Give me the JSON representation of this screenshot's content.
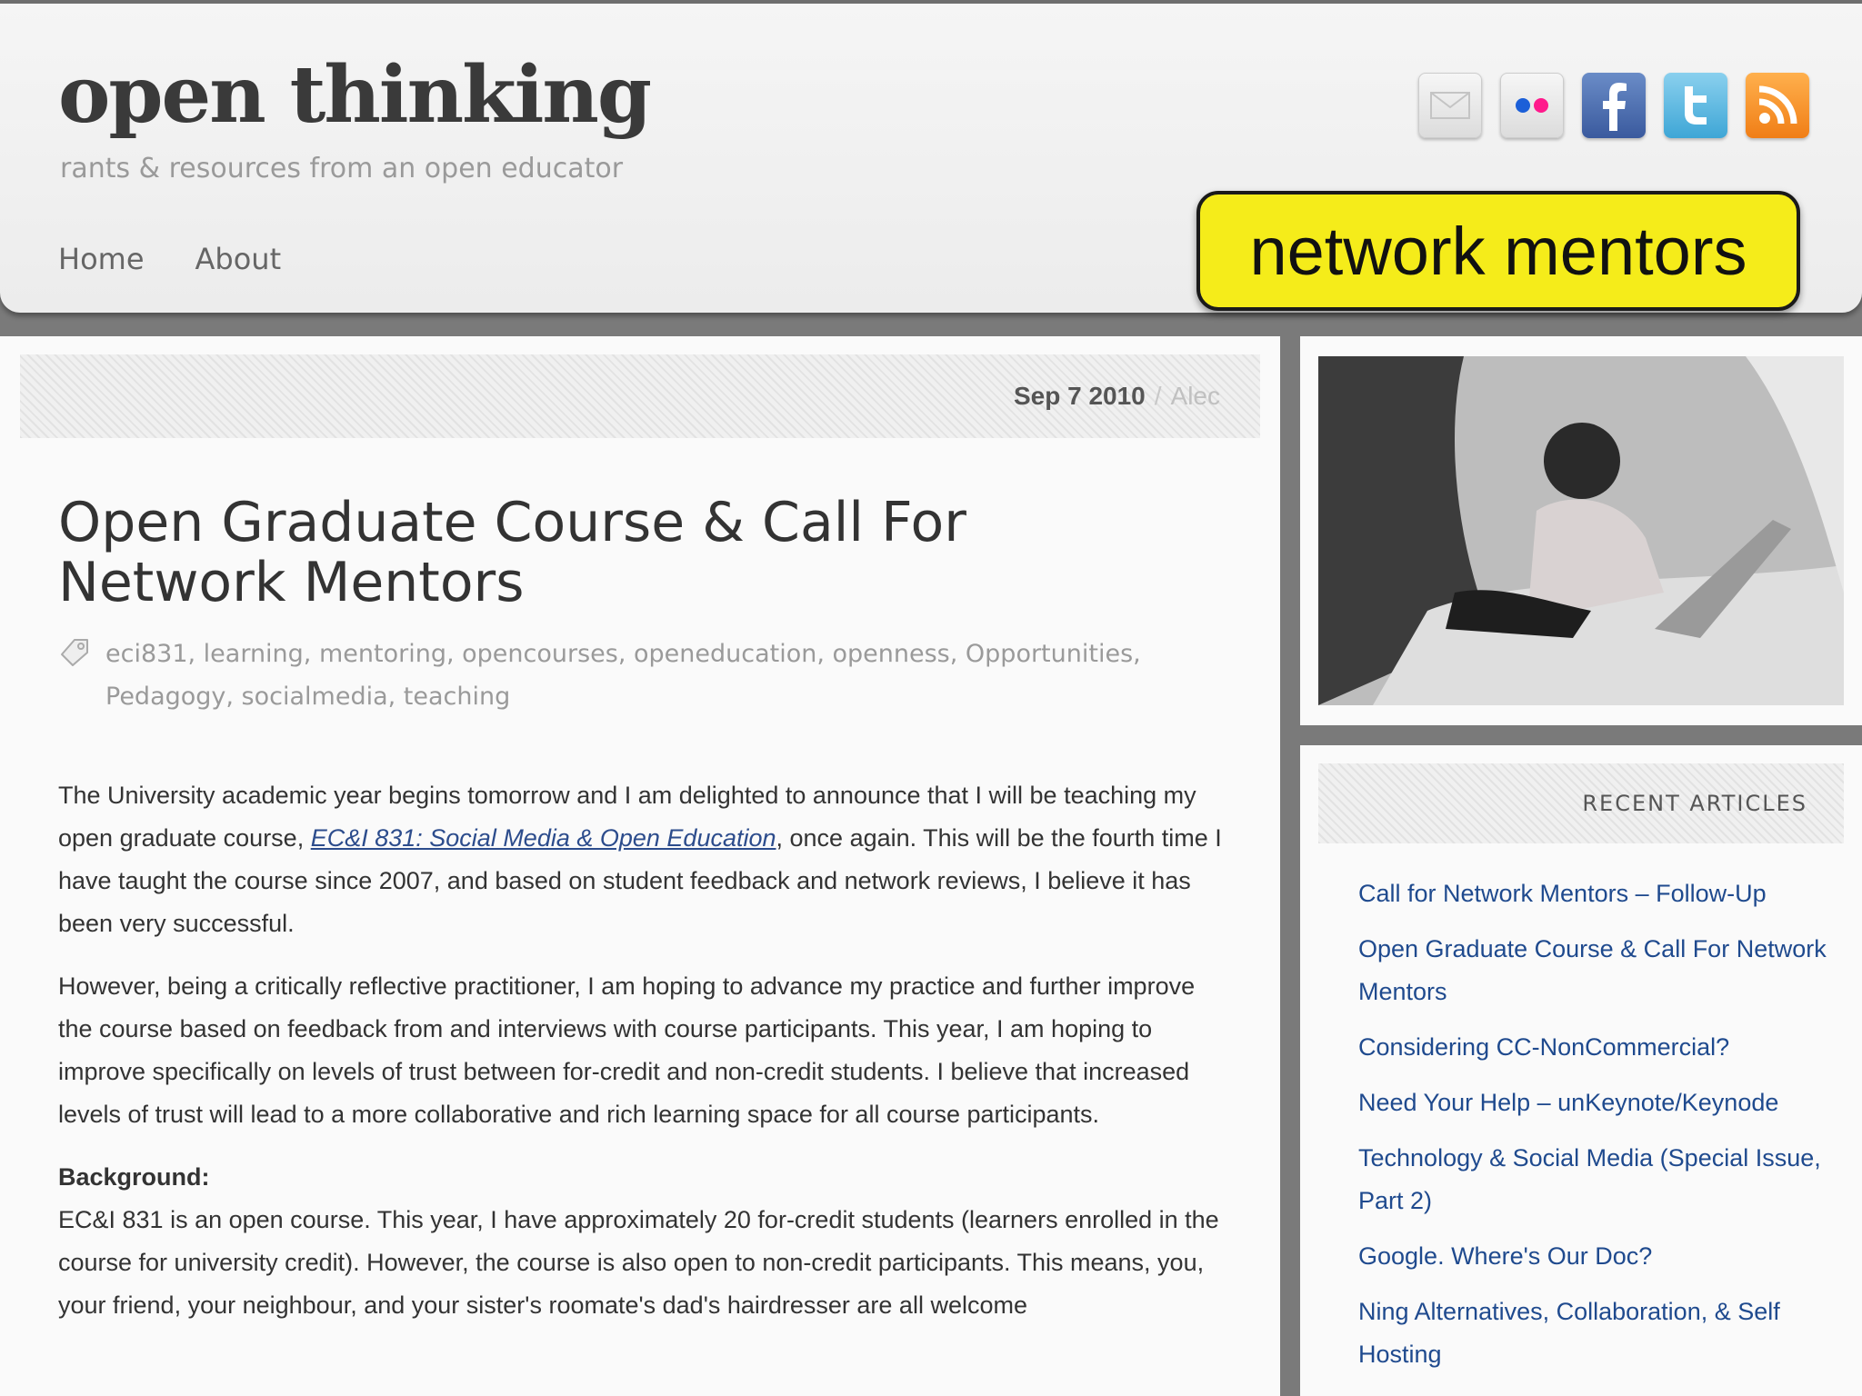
{
  "header": {
    "site_title": "open thinking",
    "tagline": "rants & resources from an open educator",
    "nav": [
      "Home",
      "About"
    ],
    "social_icons": [
      "mail-icon",
      "flickr-icon",
      "facebook-icon",
      "twitter-icon",
      "rss-icon"
    ]
  },
  "callout": {
    "text": "network mentors",
    "color": "#f5ec1a"
  },
  "post": {
    "date": "Sep 7 2010",
    "separator": "/",
    "author": "Alec",
    "title": "Open Graduate Course & Call For Network Mentors",
    "tags": "eci831, learning, mentoring, opencourses, openeducation, openness, Opportunities, Pedagogy, socialmedia, teaching",
    "p1_before": "The University academic year begins tomorrow and I am delighted to announce that I will be teaching my open graduate course, ",
    "p1_link": "EC&I 831: Social Media & Open Education",
    "p1_after": ", once again. This will be the fourth time I have taught the course since 2007, and based on student feedback and network reviews, I believe it has been very successful.",
    "p2": "However, being a critically reflective practitioner, I am hoping to advance my practice and further improve the course based on feedback from and interviews with course participants. This year, I am hoping to improve specifically on levels of trust between for-credit and non-credit students. I believe that increased levels of trust will lead to a more collaborative and rich learning space for all course participants.",
    "background_heading": "Background:",
    "p3": "EC&I 831 is an open course. This year, I have approximately 20 for-credit students (learners enrolled in the course for university credit). However, the course is also open to non-credit participants. This means, you, your friend, your neighbour, and your sister's roomate's dad's hairdresser are all welcome"
  },
  "sidebar": {
    "recent_heading": "RECENT ARTICLES",
    "recent": [
      "Call for Network Mentors – Follow-Up",
      "Open Graduate Course & Call For Network Mentors",
      "Considering CC-NonCommercial?",
      "Need Your Help – unKeynote/Keynode",
      "Technology & Social Media (Special Issue, Part 2)",
      "Google. Where's Our Doc?",
      "Ning Alternatives, Collaboration, & Self Hosting"
    ]
  }
}
